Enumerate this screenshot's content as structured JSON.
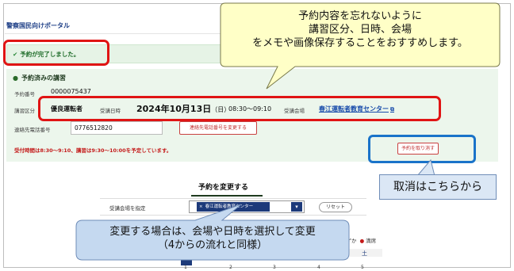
{
  "portal": {
    "title": "警察国民向けポータル"
  },
  "done": {
    "icon": "check-circle-icon",
    "text": "予約が完了しました。"
  },
  "reservation": {
    "heading": "予約済みの講習",
    "number_label": "予約番号",
    "number": "0000075437",
    "category_label": "講習区分",
    "category": "優良運転者",
    "date_label": "受講日時",
    "date": "2024年10月13日",
    "weekday": "（日）",
    "time": "08:30～09:10",
    "venue_label": "受講会場",
    "venue": "春江運転者教育センター",
    "venue_icon": "external-link-icon",
    "phone_label": "連絡先電話番号",
    "phone": "0776512820",
    "change_phone_button": "連絡先電話番号を変更する",
    "notice": "受付時間は8:30～9:10、講習は9:30～10:00を予定しています。",
    "cancel_button": "予約を取り消す"
  },
  "change": {
    "title": "予約を変更する",
    "venue_row_label": "受講会場を指定",
    "venue_tag": "春江運転者教育センター",
    "venue_tag_remove": "×",
    "reset_button": "リセット",
    "legend_fragment": "わずか",
    "legend_full": "満席",
    "saturday": "土",
    "cal_numbers": [
      "1",
      "2",
      "3",
      "4",
      "5"
    ]
  },
  "callouts": {
    "top": [
      "予約内容を忘れないように",
      "講習区分、日時、会場",
      "をメモや画像保存することをおすすめします。"
    ],
    "cancel": "取消はこちらから",
    "bottom": [
      "変更する場合は、会場や日時を選択して変更",
      "（4からの流れと同様）"
    ]
  },
  "colors": {
    "highlight_red": "#e01414",
    "highlight_blue": "#1a73c9",
    "callout_fill": "#ffffc7",
    "callout_blue_fill": "#dbe7f5",
    "navy": "#1d3a7a",
    "success_bg": "#ecf6ec"
  }
}
